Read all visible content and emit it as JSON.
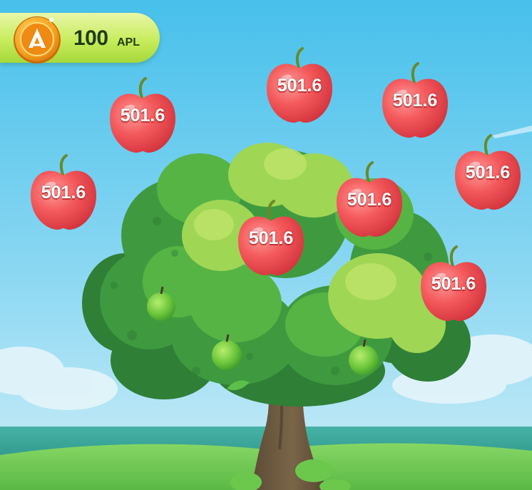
{
  "balance": {
    "amount": "100",
    "unit": "APL",
    "coin_icon": "apl-coin-icon"
  },
  "apples": [
    {
      "value": "501.6"
    },
    {
      "value": "501.6"
    },
    {
      "value": "501.6"
    },
    {
      "value": "501.6"
    },
    {
      "value": "501.6"
    },
    {
      "value": "501.6"
    },
    {
      "value": "501.6"
    },
    {
      "value": "501.6"
    }
  ],
  "colors": {
    "sky_top": "#4cc3ec",
    "sky_bottom": "#bfeaf6",
    "sea": "#3aa69a",
    "grass": "#7bd15a",
    "apple_red": "#f04a4e",
    "coin_orange": "#f7a21e",
    "balance_pill": "#c8ec5c"
  }
}
